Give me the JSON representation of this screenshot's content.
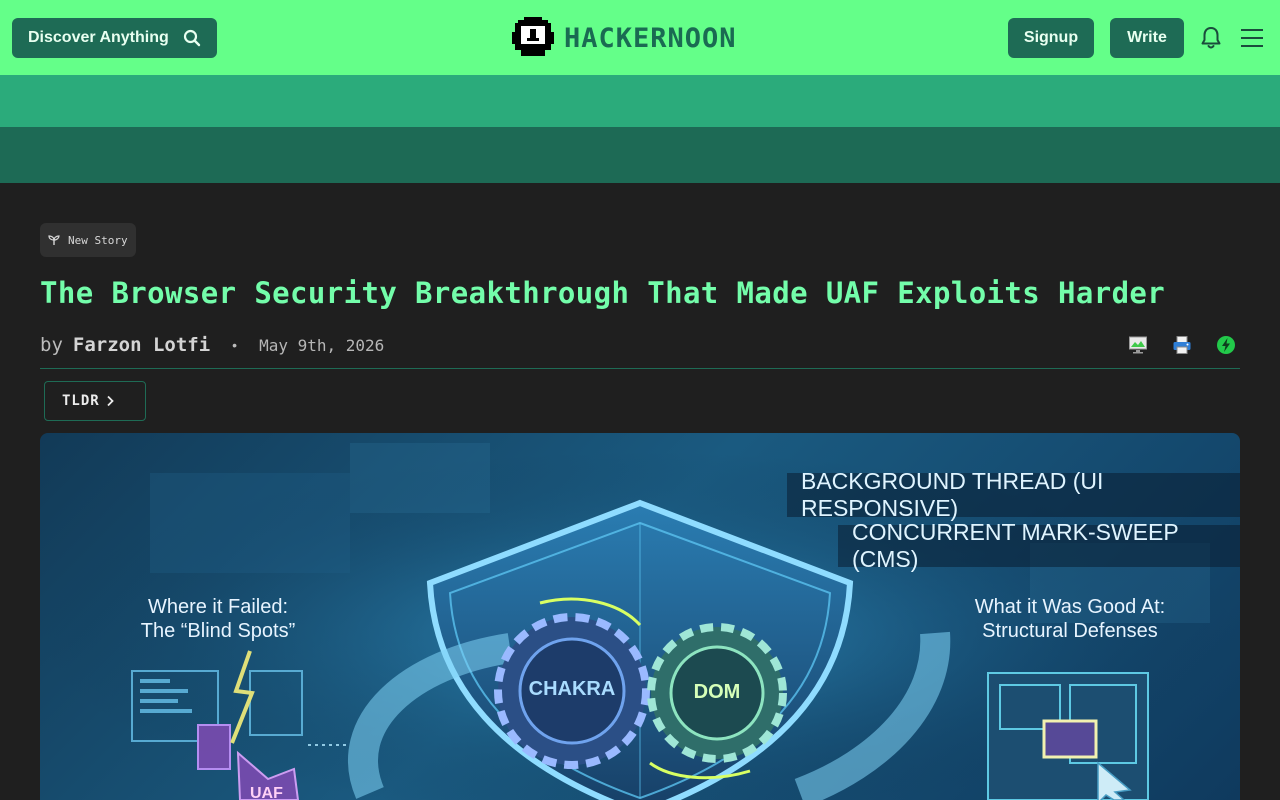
{
  "header": {
    "discover_label": "Discover Anything",
    "logo_text": "HACKERNOON",
    "signup_label": "Signup",
    "write_label": "Write"
  },
  "article": {
    "badge": "New Story",
    "title": "The Browser Security Breakthrough That Made UAF Exploits Harder",
    "by": "by",
    "author": "Farzon Lotfi",
    "separator": "•",
    "date": "May 9th, 2026",
    "tldr_label": "TLDR"
  },
  "hero": {
    "background_thread": "BACKGROUND THREAD (UI RESPONSIVE)",
    "concurrent": "CONCURRENT MARK-SWEEP (CMS)",
    "fail_line1": "Where it Failed:",
    "fail_line2": "The “Blind Spots”",
    "good_line1": "What it Was Good At:",
    "good_line2": "Structural Defenses",
    "gear_left": "CHAKRA",
    "gear_right": "DOM",
    "uaf": "UAF"
  },
  "colors": {
    "topbar": "#64ff89",
    "accent_dark": "#1e6b55",
    "band_mid": "#2bab7b",
    "title": "#73fdaa",
    "page_bg": "#1f1f1f"
  }
}
